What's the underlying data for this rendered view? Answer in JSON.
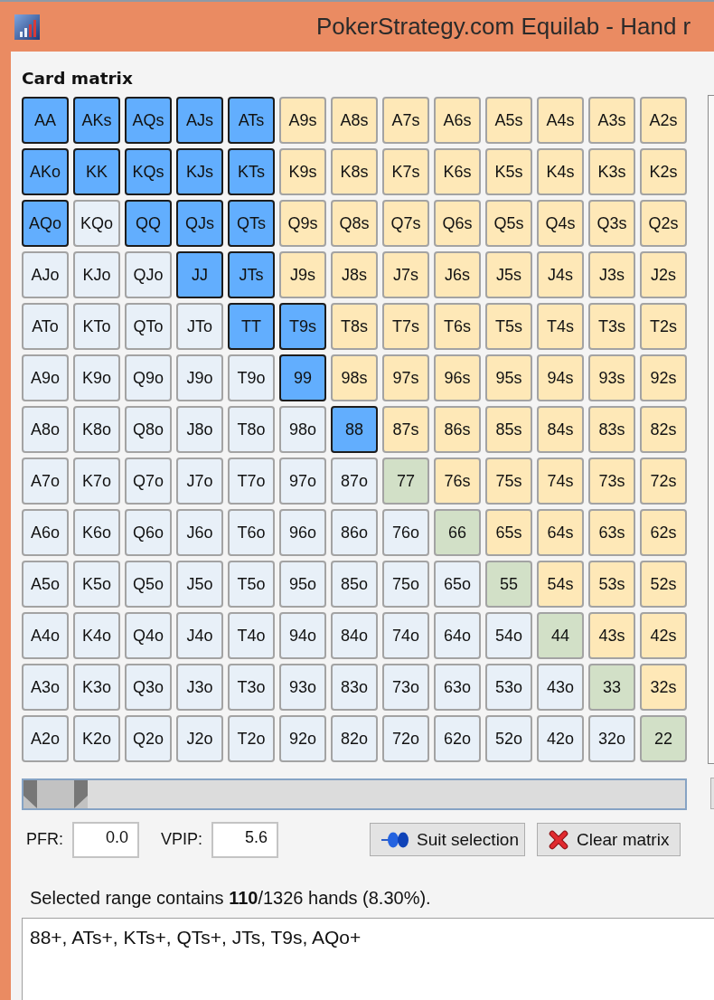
{
  "window": {
    "title": "PokerStrategy.com Equilab - Hand r"
  },
  "matrix": {
    "title": "Card matrix",
    "rows": [
      [
        {
          "label": "AA",
          "kind": "pair",
          "selected": true
        },
        {
          "label": "AKs",
          "kind": "suited",
          "selected": true
        },
        {
          "label": "AQs",
          "kind": "suited",
          "selected": true
        },
        {
          "label": "AJs",
          "kind": "suited",
          "selected": true
        },
        {
          "label": "ATs",
          "kind": "suited",
          "selected": true
        },
        {
          "label": "A9s",
          "kind": "suited",
          "selected": false
        },
        {
          "label": "A8s",
          "kind": "suited",
          "selected": false
        },
        {
          "label": "A7s",
          "kind": "suited",
          "selected": false
        },
        {
          "label": "A6s",
          "kind": "suited",
          "selected": false
        },
        {
          "label": "A5s",
          "kind": "suited",
          "selected": false
        },
        {
          "label": "A4s",
          "kind": "suited",
          "selected": false
        },
        {
          "label": "A3s",
          "kind": "suited",
          "selected": false
        },
        {
          "label": "A2s",
          "kind": "suited",
          "selected": false
        }
      ],
      [
        {
          "label": "AKo",
          "kind": "offsuit",
          "selected": true
        },
        {
          "label": "KK",
          "kind": "pair",
          "selected": true
        },
        {
          "label": "KQs",
          "kind": "suited",
          "selected": true
        },
        {
          "label": "KJs",
          "kind": "suited",
          "selected": true
        },
        {
          "label": "KTs",
          "kind": "suited",
          "selected": true
        },
        {
          "label": "K9s",
          "kind": "suited",
          "selected": false
        },
        {
          "label": "K8s",
          "kind": "suited",
          "selected": false
        },
        {
          "label": "K7s",
          "kind": "suited",
          "selected": false
        },
        {
          "label": "K6s",
          "kind": "suited",
          "selected": false
        },
        {
          "label": "K5s",
          "kind": "suited",
          "selected": false
        },
        {
          "label": "K4s",
          "kind": "suited",
          "selected": false
        },
        {
          "label": "K3s",
          "kind": "suited",
          "selected": false
        },
        {
          "label": "K2s",
          "kind": "suited",
          "selected": false
        }
      ],
      [
        {
          "label": "AQo",
          "kind": "offsuit",
          "selected": true
        },
        {
          "label": "KQo",
          "kind": "offsuit",
          "selected": false
        },
        {
          "label": "QQ",
          "kind": "pair",
          "selected": true
        },
        {
          "label": "QJs",
          "kind": "suited",
          "selected": true
        },
        {
          "label": "QTs",
          "kind": "suited",
          "selected": true
        },
        {
          "label": "Q9s",
          "kind": "suited",
          "selected": false
        },
        {
          "label": "Q8s",
          "kind": "suited",
          "selected": false
        },
        {
          "label": "Q7s",
          "kind": "suited",
          "selected": false
        },
        {
          "label": "Q6s",
          "kind": "suited",
          "selected": false
        },
        {
          "label": "Q5s",
          "kind": "suited",
          "selected": false
        },
        {
          "label": "Q4s",
          "kind": "suited",
          "selected": false
        },
        {
          "label": "Q3s",
          "kind": "suited",
          "selected": false
        },
        {
          "label": "Q2s",
          "kind": "suited",
          "selected": false
        }
      ],
      [
        {
          "label": "AJo",
          "kind": "offsuit",
          "selected": false
        },
        {
          "label": "KJo",
          "kind": "offsuit",
          "selected": false
        },
        {
          "label": "QJo",
          "kind": "offsuit",
          "selected": false
        },
        {
          "label": "JJ",
          "kind": "pair",
          "selected": true
        },
        {
          "label": "JTs",
          "kind": "suited",
          "selected": true
        },
        {
          "label": "J9s",
          "kind": "suited",
          "selected": false
        },
        {
          "label": "J8s",
          "kind": "suited",
          "selected": false
        },
        {
          "label": "J7s",
          "kind": "suited",
          "selected": false
        },
        {
          "label": "J6s",
          "kind": "suited",
          "selected": false
        },
        {
          "label": "J5s",
          "kind": "suited",
          "selected": false
        },
        {
          "label": "J4s",
          "kind": "suited",
          "selected": false
        },
        {
          "label": "J3s",
          "kind": "suited",
          "selected": false
        },
        {
          "label": "J2s",
          "kind": "suited",
          "selected": false
        }
      ],
      [
        {
          "label": "ATo",
          "kind": "offsuit",
          "selected": false
        },
        {
          "label": "KTo",
          "kind": "offsuit",
          "selected": false
        },
        {
          "label": "QTo",
          "kind": "offsuit",
          "selected": false
        },
        {
          "label": "JTo",
          "kind": "offsuit",
          "selected": false
        },
        {
          "label": "TT",
          "kind": "pair",
          "selected": true
        },
        {
          "label": "T9s",
          "kind": "suited",
          "selected": true
        },
        {
          "label": "T8s",
          "kind": "suited",
          "selected": false
        },
        {
          "label": "T7s",
          "kind": "suited",
          "selected": false
        },
        {
          "label": "T6s",
          "kind": "suited",
          "selected": false
        },
        {
          "label": "T5s",
          "kind": "suited",
          "selected": false
        },
        {
          "label": "T4s",
          "kind": "suited",
          "selected": false
        },
        {
          "label": "T3s",
          "kind": "suited",
          "selected": false
        },
        {
          "label": "T2s",
          "kind": "suited",
          "selected": false
        }
      ],
      [
        {
          "label": "A9o",
          "kind": "offsuit",
          "selected": false
        },
        {
          "label": "K9o",
          "kind": "offsuit",
          "selected": false
        },
        {
          "label": "Q9o",
          "kind": "offsuit",
          "selected": false
        },
        {
          "label": "J9o",
          "kind": "offsuit",
          "selected": false
        },
        {
          "label": "T9o",
          "kind": "offsuit",
          "selected": false
        },
        {
          "label": "99",
          "kind": "pair",
          "selected": true
        },
        {
          "label": "98s",
          "kind": "suited",
          "selected": false
        },
        {
          "label": "97s",
          "kind": "suited",
          "selected": false
        },
        {
          "label": "96s",
          "kind": "suited",
          "selected": false
        },
        {
          "label": "95s",
          "kind": "suited",
          "selected": false
        },
        {
          "label": "94s",
          "kind": "suited",
          "selected": false
        },
        {
          "label": "93s",
          "kind": "suited",
          "selected": false
        },
        {
          "label": "92s",
          "kind": "suited",
          "selected": false
        }
      ],
      [
        {
          "label": "A8o",
          "kind": "offsuit",
          "selected": false
        },
        {
          "label": "K8o",
          "kind": "offsuit",
          "selected": false
        },
        {
          "label": "Q8o",
          "kind": "offsuit",
          "selected": false
        },
        {
          "label": "J8o",
          "kind": "offsuit",
          "selected": false
        },
        {
          "label": "T8o",
          "kind": "offsuit",
          "selected": false
        },
        {
          "label": "98o",
          "kind": "offsuit",
          "selected": false
        },
        {
          "label": "88",
          "kind": "pair",
          "selected": true
        },
        {
          "label": "87s",
          "kind": "suited",
          "selected": false
        },
        {
          "label": "86s",
          "kind": "suited",
          "selected": false
        },
        {
          "label": "85s",
          "kind": "suited",
          "selected": false
        },
        {
          "label": "84s",
          "kind": "suited",
          "selected": false
        },
        {
          "label": "83s",
          "kind": "suited",
          "selected": false
        },
        {
          "label": "82s",
          "kind": "suited",
          "selected": false
        }
      ],
      [
        {
          "label": "A7o",
          "kind": "offsuit",
          "selected": false
        },
        {
          "label": "K7o",
          "kind": "offsuit",
          "selected": false
        },
        {
          "label": "Q7o",
          "kind": "offsuit",
          "selected": false
        },
        {
          "label": "J7o",
          "kind": "offsuit",
          "selected": false
        },
        {
          "label": "T7o",
          "kind": "offsuit",
          "selected": false
        },
        {
          "label": "97o",
          "kind": "offsuit",
          "selected": false
        },
        {
          "label": "87o",
          "kind": "offsuit",
          "selected": false
        },
        {
          "label": "77",
          "kind": "pair",
          "selected": false
        },
        {
          "label": "76s",
          "kind": "suited",
          "selected": false
        },
        {
          "label": "75s",
          "kind": "suited",
          "selected": false
        },
        {
          "label": "74s",
          "kind": "suited",
          "selected": false
        },
        {
          "label": "73s",
          "kind": "suited",
          "selected": false
        },
        {
          "label": "72s",
          "kind": "suited",
          "selected": false
        }
      ],
      [
        {
          "label": "A6o",
          "kind": "offsuit",
          "selected": false
        },
        {
          "label": "K6o",
          "kind": "offsuit",
          "selected": false
        },
        {
          "label": "Q6o",
          "kind": "offsuit",
          "selected": false
        },
        {
          "label": "J6o",
          "kind": "offsuit",
          "selected": false
        },
        {
          "label": "T6o",
          "kind": "offsuit",
          "selected": false
        },
        {
          "label": "96o",
          "kind": "offsuit",
          "selected": false
        },
        {
          "label": "86o",
          "kind": "offsuit",
          "selected": false
        },
        {
          "label": "76o",
          "kind": "offsuit",
          "selected": false
        },
        {
          "label": "66",
          "kind": "pair",
          "selected": false
        },
        {
          "label": "65s",
          "kind": "suited",
          "selected": false
        },
        {
          "label": "64s",
          "kind": "suited",
          "selected": false
        },
        {
          "label": "63s",
          "kind": "suited",
          "selected": false
        },
        {
          "label": "62s",
          "kind": "suited",
          "selected": false
        }
      ],
      [
        {
          "label": "A5o",
          "kind": "offsuit",
          "selected": false
        },
        {
          "label": "K5o",
          "kind": "offsuit",
          "selected": false
        },
        {
          "label": "Q5o",
          "kind": "offsuit",
          "selected": false
        },
        {
          "label": "J5o",
          "kind": "offsuit",
          "selected": false
        },
        {
          "label": "T5o",
          "kind": "offsuit",
          "selected": false
        },
        {
          "label": "95o",
          "kind": "offsuit",
          "selected": false
        },
        {
          "label": "85o",
          "kind": "offsuit",
          "selected": false
        },
        {
          "label": "75o",
          "kind": "offsuit",
          "selected": false
        },
        {
          "label": "65o",
          "kind": "offsuit",
          "selected": false
        },
        {
          "label": "55",
          "kind": "pair",
          "selected": false
        },
        {
          "label": "54s",
          "kind": "suited",
          "selected": false
        },
        {
          "label": "53s",
          "kind": "suited",
          "selected": false
        },
        {
          "label": "52s",
          "kind": "suited",
          "selected": false
        }
      ],
      [
        {
          "label": "A4o",
          "kind": "offsuit",
          "selected": false
        },
        {
          "label": "K4o",
          "kind": "offsuit",
          "selected": false
        },
        {
          "label": "Q4o",
          "kind": "offsuit",
          "selected": false
        },
        {
          "label": "J4o",
          "kind": "offsuit",
          "selected": false
        },
        {
          "label": "T4o",
          "kind": "offsuit",
          "selected": false
        },
        {
          "label": "94o",
          "kind": "offsuit",
          "selected": false
        },
        {
          "label": "84o",
          "kind": "offsuit",
          "selected": false
        },
        {
          "label": "74o",
          "kind": "offsuit",
          "selected": false
        },
        {
          "label": "64o",
          "kind": "offsuit",
          "selected": false
        },
        {
          "label": "54o",
          "kind": "offsuit",
          "selected": false
        },
        {
          "label": "44",
          "kind": "pair",
          "selected": false
        },
        {
          "label": "43s",
          "kind": "suited",
          "selected": false
        },
        {
          "label": "42s",
          "kind": "suited",
          "selected": false
        }
      ],
      [
        {
          "label": "A3o",
          "kind": "offsuit",
          "selected": false
        },
        {
          "label": "K3o",
          "kind": "offsuit",
          "selected": false
        },
        {
          "label": "Q3o",
          "kind": "offsuit",
          "selected": false
        },
        {
          "label": "J3o",
          "kind": "offsuit",
          "selected": false
        },
        {
          "label": "T3o",
          "kind": "offsuit",
          "selected": false
        },
        {
          "label": "93o",
          "kind": "offsuit",
          "selected": false
        },
        {
          "label": "83o",
          "kind": "offsuit",
          "selected": false
        },
        {
          "label": "73o",
          "kind": "offsuit",
          "selected": false
        },
        {
          "label": "63o",
          "kind": "offsuit",
          "selected": false
        },
        {
          "label": "53o",
          "kind": "offsuit",
          "selected": false
        },
        {
          "label": "43o",
          "kind": "offsuit",
          "selected": false
        },
        {
          "label": "33",
          "kind": "pair",
          "selected": false
        },
        {
          "label": "32s",
          "kind": "suited",
          "selected": false
        }
      ],
      [
        {
          "label": "A2o",
          "kind": "offsuit",
          "selected": false
        },
        {
          "label": "K2o",
          "kind": "offsuit",
          "selected": false
        },
        {
          "label": "Q2o",
          "kind": "offsuit",
          "selected": false
        },
        {
          "label": "J2o",
          "kind": "offsuit",
          "selected": false
        },
        {
          "label": "T2o",
          "kind": "offsuit",
          "selected": false
        },
        {
          "label": "92o",
          "kind": "offsuit",
          "selected": false
        },
        {
          "label": "82o",
          "kind": "offsuit",
          "selected": false
        },
        {
          "label": "72o",
          "kind": "offsuit",
          "selected": false
        },
        {
          "label": "62o",
          "kind": "offsuit",
          "selected": false
        },
        {
          "label": "52o",
          "kind": "offsuit",
          "selected": false
        },
        {
          "label": "42o",
          "kind": "offsuit",
          "selected": false
        },
        {
          "label": "32o",
          "kind": "offsuit",
          "selected": false
        },
        {
          "label": "22",
          "kind": "pair",
          "selected": false
        }
      ]
    ]
  },
  "slider": {
    "level": 0.097
  },
  "fields": [
    {
      "label": "PFR:",
      "value": "0.0"
    },
    {
      "label": "VPIP:",
      "value": "5.6"
    }
  ],
  "suit_button": {
    "label": "Suit selection"
  },
  "clear_button": {
    "label": "Clear matrix"
  },
  "summary": "Selected range contains **110**/1326 hands (8.30%).",
  "range_text": {
    "value": "88+, ATs+, KTs+, QTs+, JTs, T9s, AQo+"
  }
}
